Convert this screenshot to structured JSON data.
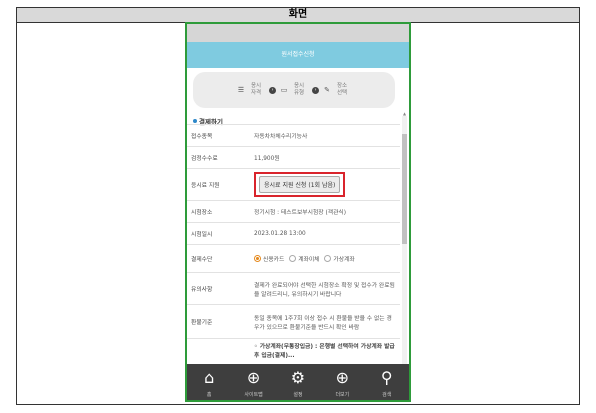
{
  "frame": {
    "title": "화면"
  },
  "app": {
    "title_bar": "원서접수신청",
    "steps": [
      {
        "icon": "list-icon",
        "label": "응시\n자격"
      },
      {
        "icon": "doc-icon",
        "label": "응시\n유형"
      },
      {
        "icon": "pencil-icon",
        "label": "장소\n선택"
      }
    ],
    "section_title": "결제하기",
    "rows": [
      {
        "label": "접수종목",
        "value": "자동차차체수리기능사"
      },
      {
        "label": "검정수수료",
        "value": "11,900원"
      },
      {
        "label": "응시료 지원",
        "button": "응시료 지원 신청 (1회 남음)"
      },
      {
        "label": "시험장소",
        "value": "정기시험 : 테스트보부시험장 (객관식)"
      },
      {
        "label": "시험일시",
        "value": "2023.01.28 13:00"
      },
      {
        "label": "결제수단",
        "options": [
          "신용카드",
          "계좌이체",
          "가상계좌"
        ],
        "selected": 0
      },
      {
        "label": "유의사항",
        "value": "결제가 완료되어야 선택한 시험장소 확정 및 접수가 완료됨을 알려드리니, 유의하시기 바랍니다"
      },
      {
        "label": "환불기준",
        "value": "동일 종목에 1주7회 이상 접수 시 환불을 받을 수 없는 경우가 있으므로 환불기준을 반드시 확인 바람"
      },
      {
        "label": "",
        "value": "◦ 가상계좌(무통장입금) : 은행별 선택하여 가상계좌 발급 후 입금(결제)..."
      }
    ],
    "nav": [
      {
        "icon": "home-icon",
        "label": "홈"
      },
      {
        "icon": "globe-icon",
        "label": "사이트맵"
      },
      {
        "icon": "gear-icon",
        "label": "설정"
      },
      {
        "icon": "plus-icon",
        "label": "더보기"
      },
      {
        "icon": "search-icon",
        "label": "검색"
      }
    ],
    "colors": {
      "titlebar": "#7fcbe0",
      "border": "#2e9b3a",
      "highlight": "#d9242c",
      "radio": "#e58a1f"
    }
  }
}
